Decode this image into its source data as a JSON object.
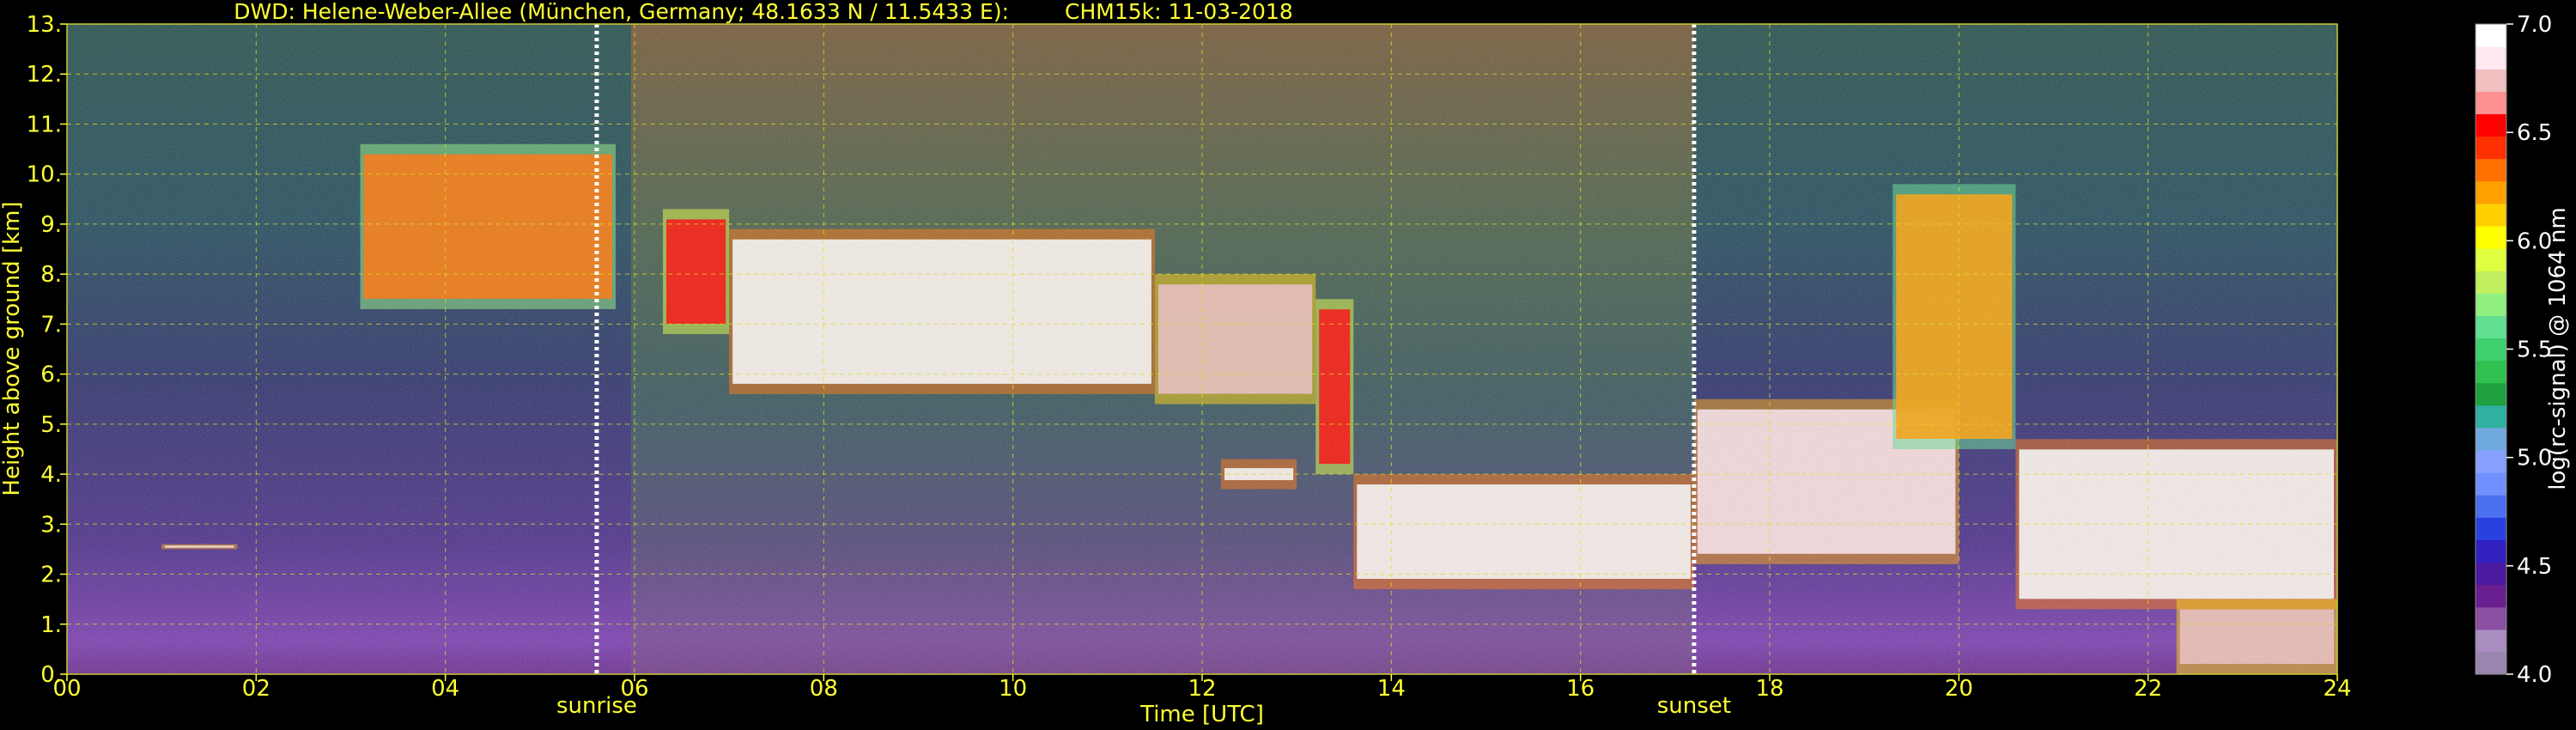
{
  "chart_data": {
    "type": "heatmap",
    "title_left": "DWD: Helene-Weber-Allee (München, Germany; 48.1633 N / 11.5433 E):",
    "title_right": "CHM15k: 11-03-2018",
    "xlabel": "Time [UTC]",
    "ylabel": "Height above ground [km]",
    "colorbar_label": "log(rc-signal) @ 1064 nm",
    "xlim": [
      0,
      24
    ],
    "ylim": [
      0,
      13
    ],
    "x_ticks": [
      "00",
      "02",
      "04",
      "06",
      "08",
      "10",
      "12",
      "14",
      "16",
      "18",
      "20",
      "22",
      "24"
    ],
    "y_ticks": [
      "0.",
      "1.",
      "2.",
      "3.",
      "4.",
      "5.",
      "6.",
      "7.",
      "8.",
      "9.",
      "10.",
      "11.",
      "12.",
      "13."
    ],
    "colorbar_range": [
      4.0,
      7.0
    ],
    "colorbar_ticks": [
      "4.0",
      "4.5",
      "5.0",
      "5.5",
      "6.0",
      "6.5",
      "7.0"
    ],
    "colorbar_colors": [
      "#9a86b0",
      "#a98cc0",
      "#8a4fa0",
      "#6a1f90",
      "#4a1aa0",
      "#3020c0",
      "#2840e0",
      "#4a70f0",
      "#7090ff",
      "#88a0ff",
      "#70a8e0",
      "#30b0a0",
      "#20a040",
      "#30c050",
      "#40d070",
      "#60e090",
      "#90f080",
      "#c0f060",
      "#e0ff40",
      "#ffff00",
      "#ffd000",
      "#ffa000",
      "#ff7000",
      "#ff3000",
      "#ff0000",
      "#ff9090",
      "#f0c0c0",
      "#ffe8f0",
      "#ffffff"
    ],
    "events": [
      {
        "label": "sunrise",
        "time": 5.6
      },
      {
        "label": "sunset",
        "time": 17.2
      }
    ],
    "grid": true,
    "layers": [
      {
        "t": [
          3.1,
          5.8
        ],
        "base": 7.3,
        "top": 10.6,
        "intensity": 6.3
      },
      {
        "t": [
          6.3,
          7.0
        ],
        "base": 6.8,
        "top": 9.3,
        "intensity": 6.5
      },
      {
        "t": [
          7.0,
          11.5
        ],
        "base": 5.6,
        "top": 8.9,
        "intensity": 6.9
      },
      {
        "t": [
          11.5,
          13.2
        ],
        "base": 5.4,
        "top": 8.0,
        "intensity": 6.7
      },
      {
        "t": [
          12.2,
          13.0
        ],
        "base": 3.7,
        "top": 4.3,
        "intensity": 6.9
      },
      {
        "t": [
          13.2,
          13.6
        ],
        "base": 4.0,
        "top": 7.5,
        "intensity": 6.5
      },
      {
        "t": [
          13.6,
          17.2
        ],
        "base": 1.7,
        "top": 4.0,
        "intensity": 6.9
      },
      {
        "t": [
          17.2,
          20.0
        ],
        "base": 2.2,
        "top": 5.5,
        "intensity": 6.8
      },
      {
        "t": [
          19.3,
          20.6
        ],
        "base": 4.5,
        "top": 9.8,
        "intensity": 6.2
      },
      {
        "t": [
          20.6,
          24.0
        ],
        "base": 1.3,
        "top": 4.7,
        "intensity": 6.9
      },
      {
        "t": [
          22.3,
          24.0
        ],
        "base": 0.0,
        "top": 1.5,
        "intensity": 6.7
      },
      {
        "t": [
          1.0,
          1.8
        ],
        "base": 2.5,
        "top": 2.6,
        "intensity": 6.8
      }
    ]
  }
}
